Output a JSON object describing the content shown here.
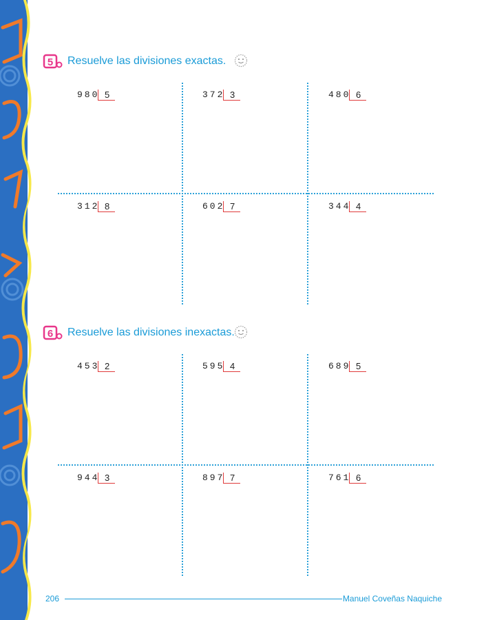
{
  "colors": {
    "accent": "#1a9bd7",
    "number_badge": "#e8378a",
    "division_bracket": "#e03a3a",
    "side_band_blue": "#2b6fc2",
    "side_band_orange": "#f07a2a",
    "side_band_yellow": "#f7e84a"
  },
  "sections": [
    {
      "number": "5",
      "title": "Resuelve las divisiones exactas.",
      "divisions": [
        {
          "dividend": "980",
          "divisor": "5"
        },
        {
          "dividend": "372",
          "divisor": "3"
        },
        {
          "dividend": "480",
          "divisor": "6"
        },
        {
          "dividend": "312",
          "divisor": "8"
        },
        {
          "dividend": "602",
          "divisor": "7"
        },
        {
          "dividend": "344",
          "divisor": "4"
        }
      ]
    },
    {
      "number": "6",
      "title": "Resuelve las divisiones inexactas.",
      "divisions": [
        {
          "dividend": "453",
          "divisor": "2"
        },
        {
          "dividend": "595",
          "divisor": "4"
        },
        {
          "dividend": "689",
          "divisor": "5"
        },
        {
          "dividend": "944",
          "divisor": "3"
        },
        {
          "dividend": "897",
          "divisor": "7"
        },
        {
          "dividend": "761",
          "divisor": "6"
        }
      ]
    }
  ],
  "footer": {
    "page_number": "206",
    "author": "Manuel Coveñas Naquiche"
  },
  "icons": [
    "smiley-icon",
    "section-number-badge"
  ]
}
